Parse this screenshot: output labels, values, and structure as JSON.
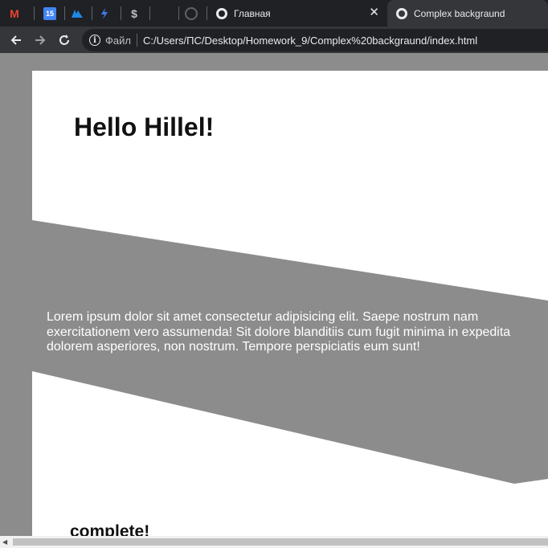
{
  "browser": {
    "tabs": [
      {
        "title": "Главная",
        "active": false
      },
      {
        "title": "Complex backgraund",
        "active": true
      }
    ],
    "close_glyph": "✕",
    "address": {
      "scheme_label": "Файл",
      "url": "C:/Users/ПС/Desktop/Homework_9/Complex%20backgraund/index.html"
    },
    "pinned_icons": [
      "gmail-icon",
      "calendar-icon",
      "app-icon",
      "lightning-icon",
      "dollar-icon",
      "blank-icon",
      "github-icon"
    ],
    "calendar_day": "15",
    "gmail_letter": "M"
  },
  "page": {
    "heading": "Hello Hillel!",
    "paragraph": "Lorem ipsum dolor sit amet consectetur adipisicing elit. Saepe nostrum nam exercitationem vero assumenda! Sit dolore blanditiis cum fugit minima in expedita dolorem asperiores, non nostrum. Tempore perspiciatis eum sunt!",
    "footer_heading": "complete!"
  },
  "colors": {
    "outer_bg": "#8c8c8c",
    "card_bg": "#ffffff",
    "band": "#8c8c8c",
    "tabbar": "#202124",
    "toolbar": "#35363a"
  }
}
